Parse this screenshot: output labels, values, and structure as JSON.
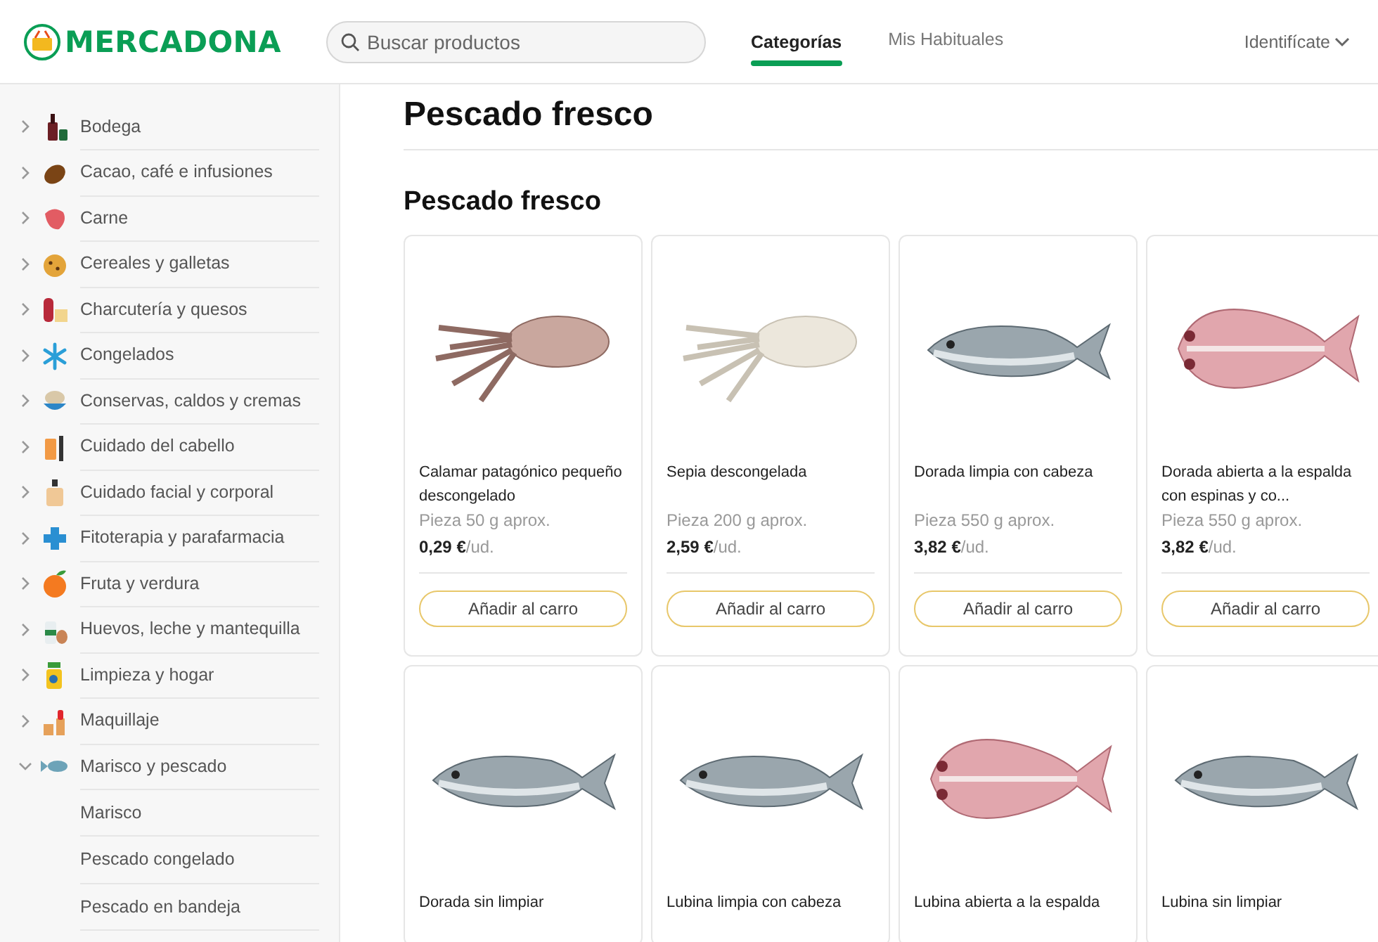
{
  "header": {
    "logo": "MERCADONA",
    "search": {
      "placeholder": "Buscar productos"
    },
    "nav": [
      {
        "label": "Categorías",
        "selected": true
      },
      {
        "label": "Mis Habituales",
        "selected": false
      }
    ],
    "account": {
      "label": "Identifícate"
    }
  },
  "sidebar": {
    "categories": [
      {
        "label": "Bodega",
        "expanded": false
      },
      {
        "label": "Cacao, café e infusiones",
        "expanded": false
      },
      {
        "label": "Carne",
        "expanded": false
      },
      {
        "label": "Cereales y galletas",
        "expanded": false
      },
      {
        "label": "Charcutería y quesos",
        "expanded": false
      },
      {
        "label": "Congelados",
        "expanded": false
      },
      {
        "label": "Conservas, caldos y cremas",
        "expanded": false
      },
      {
        "label": "Cuidado del cabello",
        "expanded": false
      },
      {
        "label": "Cuidado facial y corporal",
        "expanded": false
      },
      {
        "label": "Fitoterapia y parafarmacia",
        "expanded": false
      },
      {
        "label": "Fruta y verdura",
        "expanded": false
      },
      {
        "label": "Huevos, leche y mantequilla",
        "expanded": false
      },
      {
        "label": "Limpieza y hogar",
        "expanded": false
      },
      {
        "label": "Maquillaje",
        "expanded": false
      },
      {
        "label": "Marisco y pescado",
        "expanded": true,
        "children": [
          {
            "label": "Marisco"
          },
          {
            "label": "Pescado congelado"
          },
          {
            "label": "Pescado en bandeja"
          }
        ]
      }
    ]
  },
  "main": {
    "title": "Pescado fresco",
    "section": "Pescado fresco",
    "products": [
      {
        "kind": "squid",
        "name": "Calamar patagónico pequeño descongelado",
        "size": "Pieza 50 g aprox.",
        "price": "0,29 €",
        "unit": "/ud.",
        "button": "Añadir al carro"
      },
      {
        "kind": "cuttlefish",
        "name": "Sepia descongelada",
        "size": "Pieza 200 g aprox.",
        "price": "2,59 €",
        "unit": "/ud.",
        "button": "Añadir al carro"
      },
      {
        "kind": "fish",
        "name": "Dorada limpia con cabeza",
        "size": "Pieza 550 g aprox.",
        "price": "3,82 €",
        "unit": "/ud.",
        "button": "Añadir al carro"
      },
      {
        "kind": "open-fish",
        "name": "Dorada abierta a la espalda con espinas y co...",
        "size": "Pieza 550 g aprox.",
        "price": "3,82 €",
        "unit": "/ud.",
        "button": "Añadir al carro"
      },
      {
        "kind": "fish",
        "name": "Dorada sin limpiar"
      },
      {
        "kind": "fish",
        "name": "Lubina limpia con cabeza"
      },
      {
        "kind": "open-fish",
        "name": "Lubina abierta a la espalda"
      },
      {
        "kind": "fish",
        "name": "Lubina sin limpiar"
      }
    ]
  }
}
